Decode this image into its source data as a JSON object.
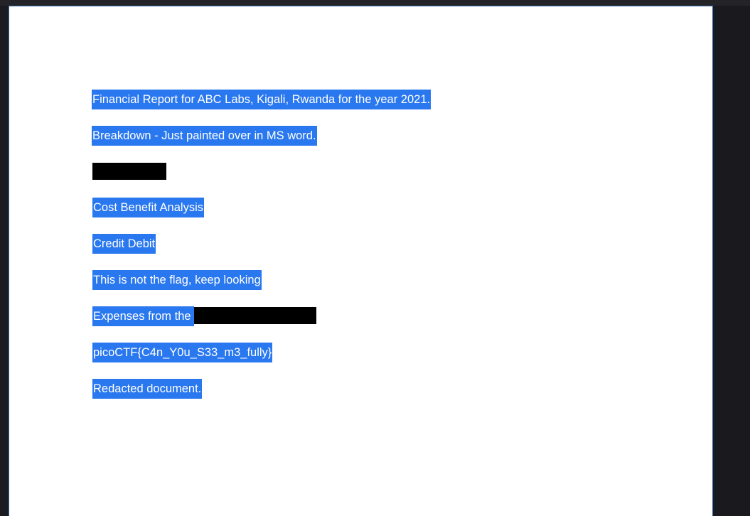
{
  "document": {
    "lines": [
      "Financial Report for ABC Labs, Kigali, Rwanda for the year 2021.",
      "Breakdown - Just painted over in MS word.",
      "Cost Benefit Analysis",
      "Credit Debit",
      "This is not the flag, keep looking",
      "Expenses from the",
      "picoCTF{C4n_Y0u_S33_m3_fully}",
      "Redacted document."
    ]
  },
  "colors": {
    "selection": "#2a78ef",
    "redaction": "#000000",
    "page": "#ffffff",
    "background": "#1c1c20"
  }
}
